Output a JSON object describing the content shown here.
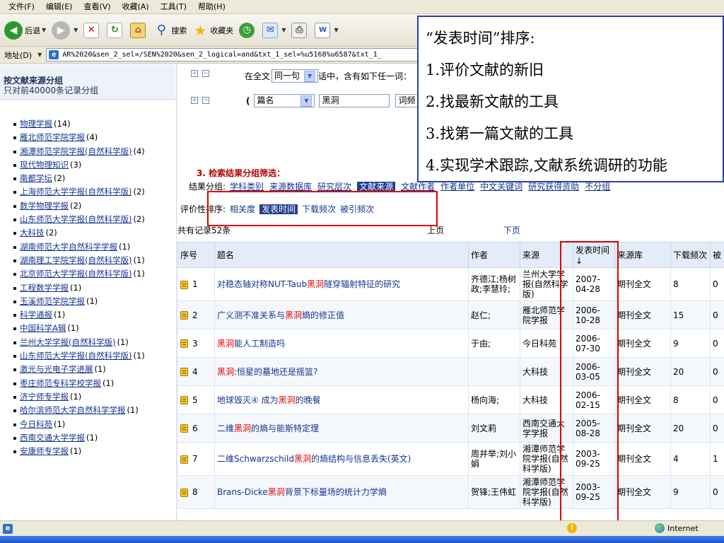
{
  "menu": [
    "文件(F)",
    "编辑(E)",
    "查看(V)",
    "收藏(A)",
    "工具(T)",
    "帮助(H)"
  ],
  "toolbar": {
    "back_label": "后退",
    "search_label": "搜索",
    "favorites_label": "收藏夹"
  },
  "address": {
    "label": "地址(D)",
    "value": "AR%2020&sen_2_sel=/SEN%2020&sen_2_logical=and&txt_1_sel=%u5168%u6587&txt_1_"
  },
  "left_panel": {
    "title": "按文献来源分组",
    "subtitle": "只对前40000条记录分组",
    "sources": [
      {
        "name": "物理学报",
        "count": "(14)"
      },
      {
        "name": "雁北师范学院学报",
        "count": "(4)"
      },
      {
        "name": "湘潭师范学院学报(自然科学版)",
        "count": "(4)"
      },
      {
        "name": "现代物理知识",
        "count": "(3)"
      },
      {
        "name": "南都学坛",
        "count": "(2)"
      },
      {
        "name": "上海师范大学学报(自然科学版)",
        "count": "(2)"
      },
      {
        "name": "数学物理学报",
        "count": "(2)"
      },
      {
        "name": "山东师范大学学报(自然科学版)",
        "count": "(2)"
      },
      {
        "name": "大科技",
        "count": "(2)"
      },
      {
        "name": "湖南师范大学自然科学学报",
        "count": "(1)"
      },
      {
        "name": "湖南理工学院学报(自然科学版)",
        "count": "(1)"
      },
      {
        "name": "北京师范大学学报(自然科学版)",
        "count": "(1)"
      },
      {
        "name": "工程数学学报",
        "count": "(1)"
      },
      {
        "name": "玉溪师范学院学报",
        "count": "(1)"
      },
      {
        "name": "科学通报",
        "count": "(1)"
      },
      {
        "name": "中国科学A辑",
        "count": "(1)"
      },
      {
        "name": "兰州大学学报(自然科学版)",
        "count": "(1)"
      },
      {
        "name": "山东师范大学学报(自然科学版)",
        "count": "(1)"
      },
      {
        "name": "激光与光电子学进展",
        "count": "(1)"
      },
      {
        "name": "枣庄师范专科学校学报",
        "count": "(1)"
      },
      {
        "name": "济宁师专学报",
        "count": "(1)"
      },
      {
        "name": "哈尔滨师范大学自然科学学报",
        "count": "(1)"
      },
      {
        "name": "今日科苑",
        "count": "(1)"
      },
      {
        "name": "西南交通大学学报",
        "count": "(1)"
      },
      {
        "name": "安康师专学报",
        "count": "(1)"
      }
    ]
  },
  "search": {
    "row1_prefix": "在全文",
    "row1_select": "同一句",
    "row1_suffix": "话中，含有如下任一词：",
    "row2_paren": "(",
    "row2_field": "篇名",
    "row2_value": "黑洞",
    "row2_tail": "词频"
  },
  "grouping": {
    "section_title": "3. 检索结果分组筛选：",
    "label": "结果分组:",
    "options": [
      "学科类别",
      "来源数据库",
      "研究层次",
      "文献来源",
      "文献作者",
      "作者单位",
      "中文关键词",
      "研究获得资助",
      "不分组"
    ],
    "active": "文献来源"
  },
  "sorting": {
    "label": "评价性排序:",
    "options": [
      "相关度",
      "发表时间",
      "下载频次",
      "被引频次"
    ],
    "active": "发表时间"
  },
  "results": {
    "count_text": "共有记录52条",
    "prev_label": "上页",
    "next_label": "下页",
    "headers": [
      "序号",
      "题名",
      "作者",
      "来源",
      "发表时间↓",
      "来源库",
      "下载频次",
      "被"
    ],
    "rows": [
      {
        "no": "1",
        "title_pre": "对稳态轴对称NUT-Taub",
        "title_hl": "黑洞",
        "title_post": "隧穿辐射特征的研究",
        "author": "齐德江;杨树政;李慧玲;",
        "source": "兰州大学学报(自然科学版)",
        "date": "2007-04-28",
        "db": "期刊全文",
        "downloads": "8",
        "cited": "0"
      },
      {
        "no": "2",
        "title_pre": "广义测不准关系与",
        "title_hl": "黑洞",
        "title_post": "熵的修正值",
        "author": "赵仁;",
        "source": "雁北师范学院学报",
        "date": "2006-10-28",
        "db": "期刊全文",
        "downloads": "15",
        "cited": "0"
      },
      {
        "no": "3",
        "title_pre": "",
        "title_hl": "黑洞",
        "title_post": "能人工制造吗",
        "author": "于由;",
        "source": "今日科苑",
        "date": "2006-07-30",
        "db": "期刊全文",
        "downloads": "9",
        "cited": "0"
      },
      {
        "no": "4",
        "title_pre": "",
        "title_hl": "黑洞",
        "title_post": ":恒星的墓地还是摇篮?",
        "author": "",
        "source": "大科技",
        "date": "2006-03-05",
        "db": "期刊全文",
        "downloads": "20",
        "cited": "0"
      },
      {
        "no": "5",
        "title_pre": "地球毁灭④ 成为",
        "title_hl": "黑洞",
        "title_post": "的晚餐",
        "author": "杨向海;",
        "source": "大科技",
        "date": "2006-02-15",
        "db": "期刊全文",
        "downloads": "8",
        "cited": "0"
      },
      {
        "no": "6",
        "title_pre": "二维",
        "title_hl": "黑洞",
        "title_post": "的熵与能斯特定理",
        "author": "刘文莉",
        "source": "西南交通大学学报",
        "date": "2005-08-28",
        "db": "期刊全文",
        "downloads": "20",
        "cited": "0"
      },
      {
        "no": "7",
        "title_pre": "二维Schwarzschild",
        "title_hl": "黑洞",
        "title_post": "的熵结构与信息丢失(英文)",
        "author": "周并举;刘小娟",
        "source": "湘潭师范学院学报(自然科学版)",
        "date": "2003-09-25",
        "db": "期刊全文",
        "downloads": "4",
        "cited": "1"
      },
      {
        "no": "8",
        "title_pre": "Brans-Dicke",
        "title_hl": "黑洞",
        "title_post": "背景下标量场的统计力学熵",
        "author": "贺锋;王伟虹",
        "source": "湘潭师范学院学报(自然科学版)",
        "date": "2003-09-25",
        "db": "期刊全文",
        "downloads": "9",
        "cited": "0"
      }
    ]
  },
  "annotation": {
    "heading": "“发表时间”排序:",
    "points": [
      "1.评价文献的新旧",
      "2.找最新文献的工具",
      "3.找第一篇文献的工具",
      "4.实现学术跟踪,文献系统调研的功能"
    ]
  },
  "status": {
    "zone": "Internet"
  },
  "colors": {
    "highlight": "#e00000",
    "link": "#12348f",
    "annotation_border": "#2c3fa8",
    "red_box": "#e00000"
  }
}
